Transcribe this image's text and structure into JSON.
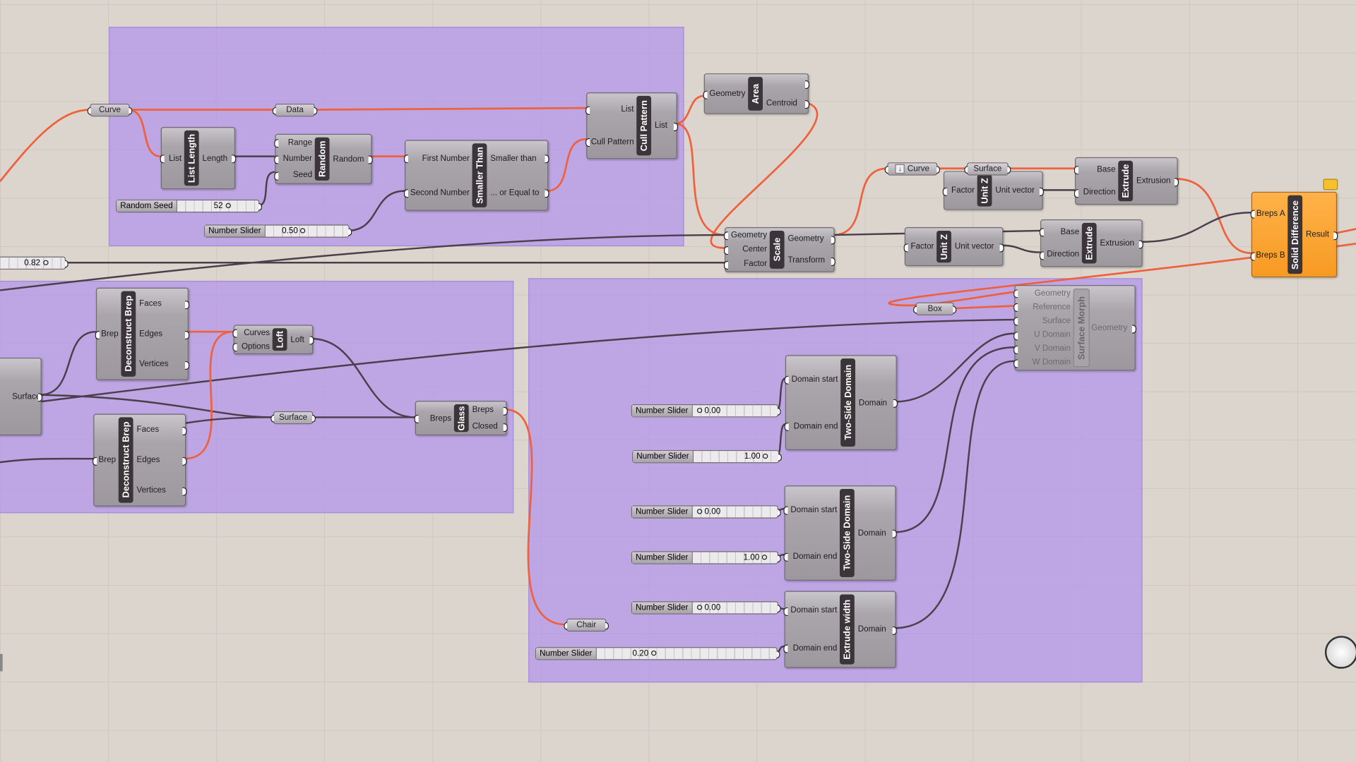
{
  "colors": {
    "canvas": "#dcd5ce",
    "group": "#c4a9ee",
    "wire_active": "#f0603a",
    "wire_default": "#4a3f4a",
    "highlight": "#f79a22"
  },
  "components": {
    "list_length": {
      "name": "List Length",
      "inputs": [
        "List"
      ],
      "outputs": [
        "Length"
      ]
    },
    "random": {
      "name": "Random",
      "inputs": [
        "Range",
        "Number",
        "Seed"
      ],
      "outputs": [
        "Random"
      ]
    },
    "smaller_than": {
      "name": "Smaller Than",
      "inputs": [
        "First Number",
        "Second Number"
      ],
      "outputs": [
        "Smaller than",
        "... or Equal to"
      ]
    },
    "cull_pattern": {
      "name": "Cull Pattern",
      "inputs": [
        "List",
        "Cull Pattern"
      ],
      "outputs": [
        "List"
      ]
    },
    "area": {
      "name": "Area",
      "inputs": [
        "Geometry"
      ],
      "outputs": [
        "",
        "Centroid"
      ]
    },
    "scale": {
      "name": "Scale",
      "inputs": [
        "Geometry",
        "Center",
        "Factor"
      ],
      "outputs": [
        "Geometry",
        "Transform"
      ]
    },
    "unit_z_1": {
      "name": "Unit Z",
      "inputs": [
        "Factor"
      ],
      "outputs": [
        "Unit vector"
      ]
    },
    "extrude_1": {
      "name": "Extrude",
      "inputs": [
        "Base",
        "Direction"
      ],
      "outputs": [
        "Extrusion"
      ]
    },
    "unit_z_2": {
      "name": "Unit Z",
      "inputs": [
        "Factor"
      ],
      "outputs": [
        "Unit vector"
      ]
    },
    "extrude_2": {
      "name": "Extrude",
      "inputs": [
        "Base",
        "Direction"
      ],
      "outputs": [
        "Extrusion"
      ]
    },
    "solid_difference": {
      "name": "Solid Difference",
      "inputs": [
        "Breps A",
        "Breps B"
      ],
      "outputs": [
        "Result"
      ]
    },
    "surface_left": {
      "name": "",
      "inputs": [],
      "outputs": [
        "Surface"
      ]
    },
    "deconstruct_brep_1": {
      "name": "Deconstruct Brep",
      "inputs": [
        "Brep"
      ],
      "outputs": [
        "Faces",
        "Edges",
        "Vertices"
      ]
    },
    "loft": {
      "name": "Loft",
      "inputs": [
        "Curves",
        "Options"
      ],
      "outputs": [
        "Loft"
      ]
    },
    "glass": {
      "name": "Glass",
      "inputs": [
        "Breps"
      ],
      "outputs": [
        "Breps",
        "Closed"
      ]
    },
    "deconstruct_brep_2": {
      "name": "Deconstruct Brep",
      "inputs": [
        "Brep"
      ],
      "outputs": [
        "Faces",
        "Edges",
        "Vertices"
      ]
    },
    "surface_morph": {
      "name": "Surface Morph",
      "inputs": [
        "Geometry",
        "Reference",
        "Surface",
        "U Domain",
        "V Domain",
        "W Domain"
      ],
      "outputs": [
        "Geometry"
      ]
    },
    "two_side_domain_1": {
      "name": "Two-Side Domain",
      "inputs": [
        "Domain start",
        "Domain end"
      ],
      "outputs": [
        "Domain"
      ]
    },
    "two_side_domain_2": {
      "name": "Two-Side Domain",
      "inputs": [
        "Domain start",
        "Domain end"
      ],
      "outputs": [
        "Domain"
      ]
    },
    "extrude_width": {
      "name": "Extrude width",
      "inputs": [
        "Domain start",
        "Domain end"
      ],
      "outputs": [
        "Domain"
      ]
    }
  },
  "params": {
    "curve_1": "Curve",
    "data": "Data",
    "curve_2": "Curve",
    "surface_1": "Surface",
    "surface_2": "Surface",
    "box": "Box",
    "chair": "Chair"
  },
  "sliders": {
    "random_seed": {
      "label": "Random Seed",
      "value": "52"
    },
    "threshold": {
      "label": "Number Slider",
      "value": "0.50"
    },
    "scale_factor": {
      "label": "",
      "value": "0.82"
    },
    "u_start": {
      "label": "Number Slider",
      "value": "0.00"
    },
    "u_end": {
      "label": "Number Slider",
      "value": "1.00"
    },
    "v_start": {
      "label": "Number Slider",
      "value": "0.00"
    },
    "v_end": {
      "label": "Number Slider",
      "value": "1.00"
    },
    "w_start": {
      "label": "Number Slider",
      "value": "0.00"
    },
    "w_end": {
      "label": "Number Slider",
      "value": "0.20"
    }
  }
}
